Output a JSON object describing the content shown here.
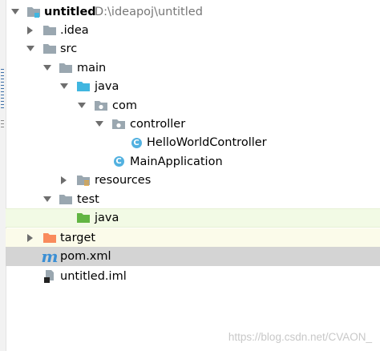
{
  "project_tree": {
    "root": {
      "name": "untitled",
      "path": "D:\\ideapoj\\untitled"
    },
    "items": [
      {
        "label": ".idea"
      },
      {
        "label": "src"
      },
      {
        "label": "main"
      },
      {
        "label": "java"
      },
      {
        "label": "com"
      },
      {
        "label": "controller"
      },
      {
        "label": "HelloWorldController"
      },
      {
        "label": "MainApplication"
      },
      {
        "label": "resources"
      },
      {
        "label": "test"
      },
      {
        "label": "java"
      },
      {
        "label": "target"
      },
      {
        "label": "pom.xml"
      },
      {
        "label": "untitled.iml"
      }
    ]
  },
  "icons": {
    "class_letter": "C",
    "maven_letter": "m"
  },
  "colors": {
    "folder_gray": "#9aa7b0",
    "folder_blue": "#40b6e0",
    "folder_green": "#62b543",
    "folder_orange": "#f98b5c",
    "class_circle": "#52b1e0",
    "test_row_bg": "#f2fae5",
    "target_row_bg": "#fbfbea",
    "pom_row_bg": "#d4d4d4"
  },
  "watermark": "https://blog.csdn.net/CVAON_"
}
